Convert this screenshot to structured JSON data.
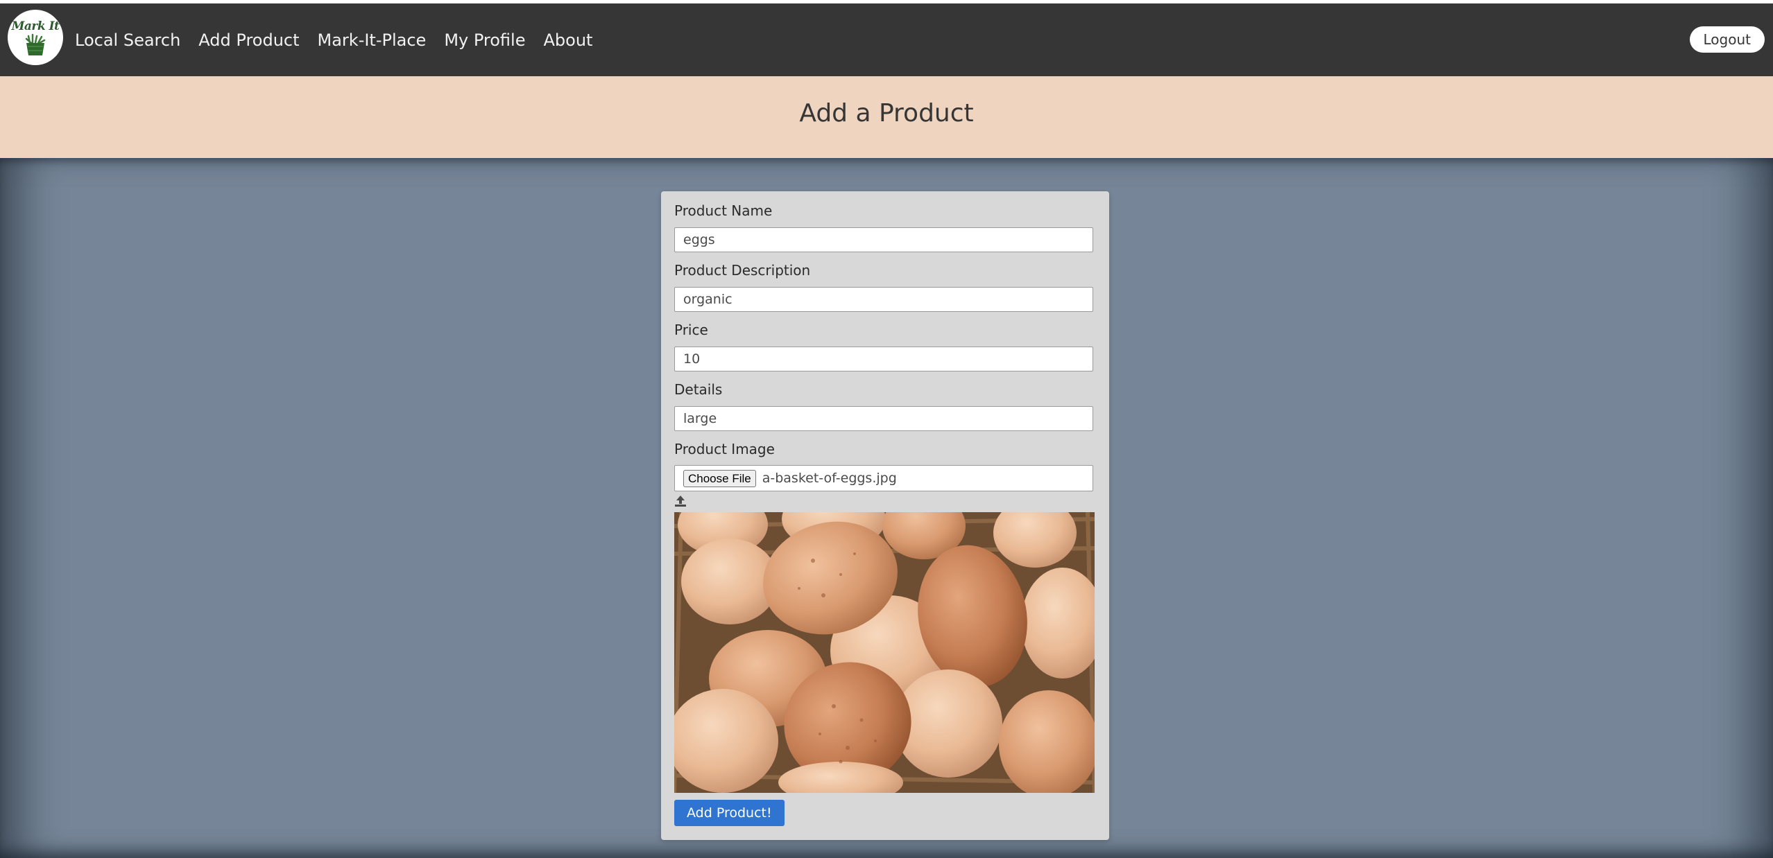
{
  "nav": {
    "logo_text": "Mark It",
    "links": [
      "Local Search",
      "Add Product",
      "Mark-It-Place",
      "My Profile",
      "About"
    ],
    "logout_label": "Logout"
  },
  "hero": {
    "title": "Add a Product"
  },
  "form": {
    "name_label": "Product Name",
    "name_value": "eggs",
    "description_label": "Product Description",
    "description_value": "organic",
    "price_label": "Price",
    "price_value": "10",
    "details_label": "Details",
    "details_value": "large",
    "image_label": "Product Image",
    "choose_file_label": "Choose File",
    "file_name": "a-basket-of-eggs.jpg",
    "submit_label": "Add Product!"
  },
  "colors": {
    "navbar": "#363636",
    "hero": "#efd5bf",
    "background": "#768698",
    "card": "#d8d8d8",
    "button": "#2f74d0"
  }
}
